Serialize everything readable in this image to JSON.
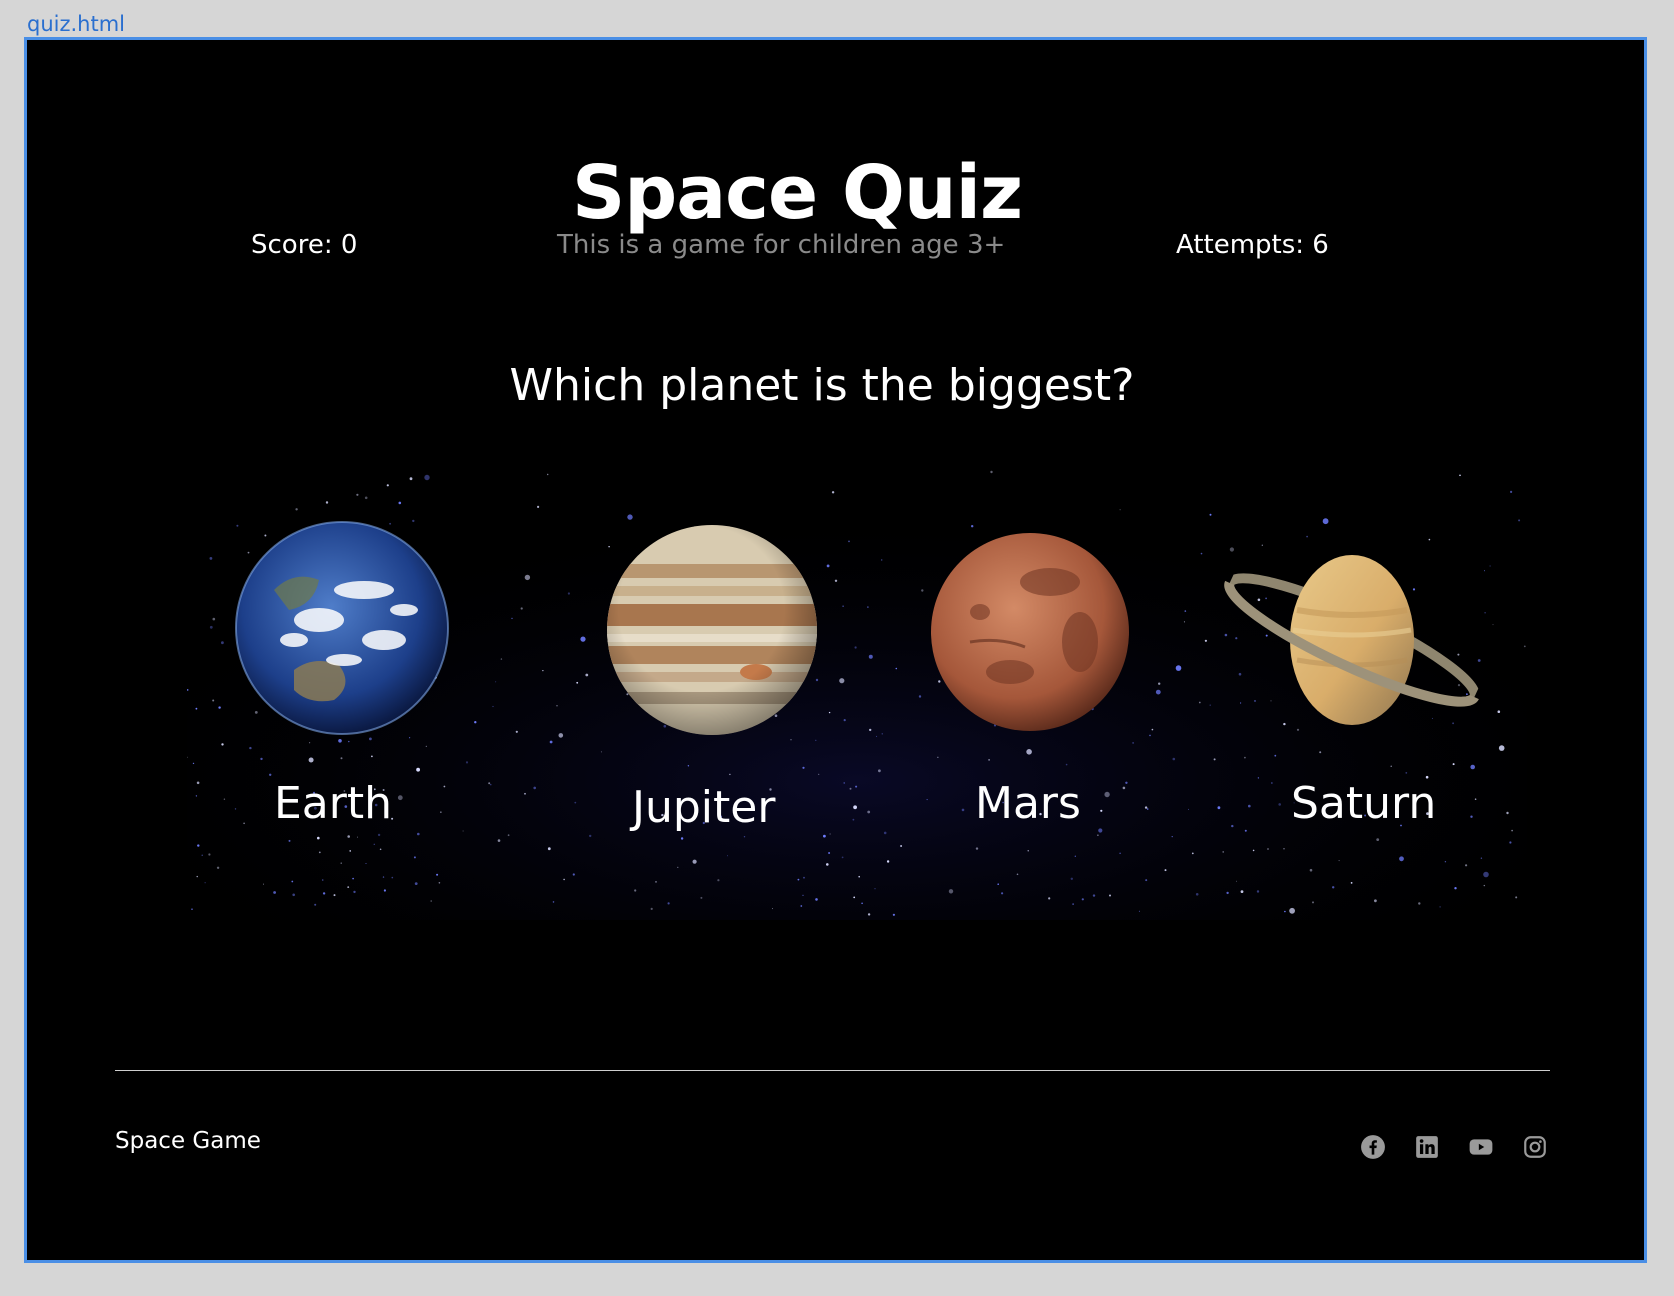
{
  "window": {
    "file_tab": "quiz.html"
  },
  "header": {
    "title": "Space Quiz",
    "score": "Score: 0",
    "subtitle": "This is a game for children age 3+",
    "attempts": "Attempts: 6"
  },
  "quiz": {
    "question": "Which planet is the biggest?",
    "options": [
      {
        "label": "Earth"
      },
      {
        "label": "Jupiter"
      },
      {
        "label": "Mars"
      },
      {
        "label": "Saturn"
      }
    ]
  },
  "footer": {
    "brand": "Space Game",
    "social_icons": [
      "facebook-icon",
      "linkedin-icon",
      "youtube-icon",
      "instagram-icon"
    ]
  },
  "colors": {
    "background": "#000000",
    "frame_border": "#4a8fe6",
    "text": "#ffffff",
    "muted_text": "#8a8a8a",
    "icon": "#9a9a9a"
  }
}
